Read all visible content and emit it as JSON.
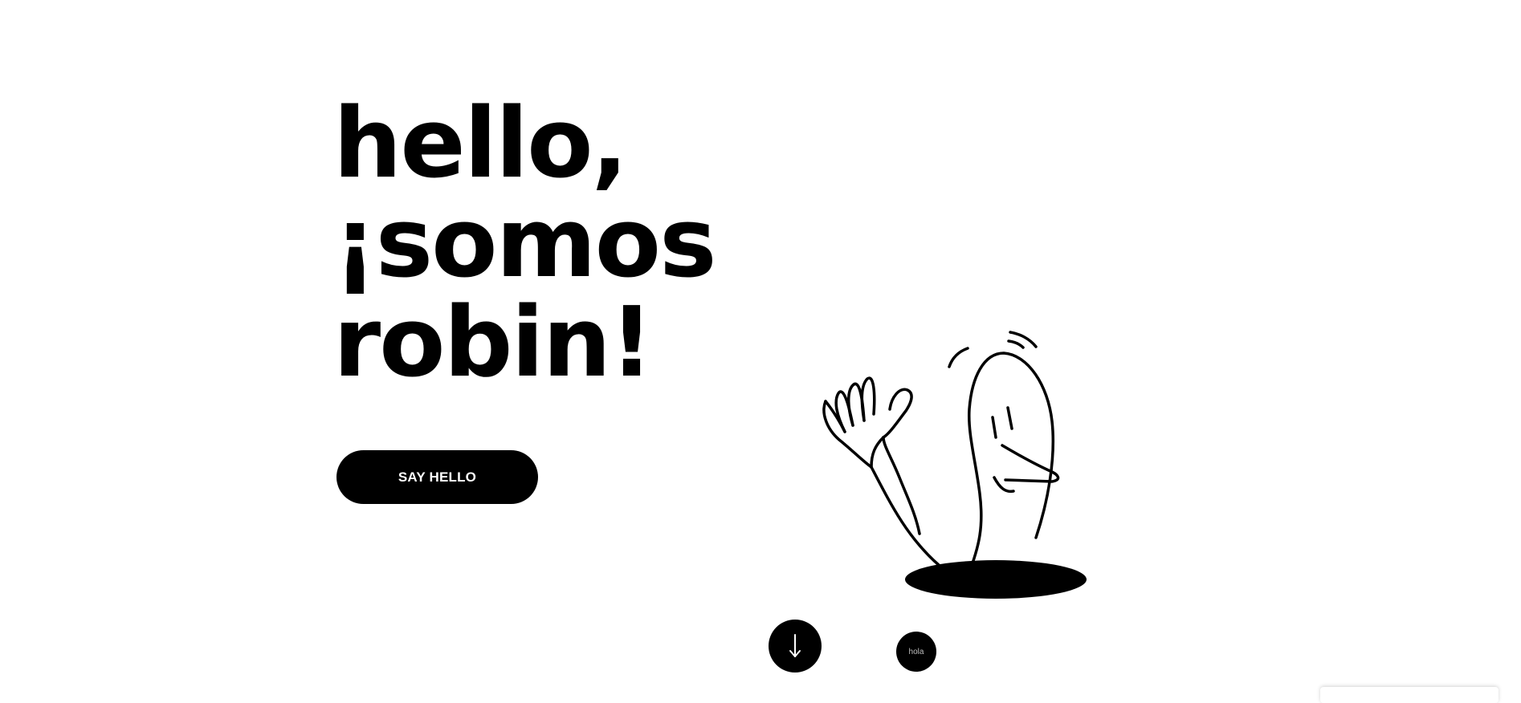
{
  "hero": {
    "line1": "hello,",
    "line2": "¡somos",
    "line3": "robin!"
  },
  "cta": {
    "label": "SAY HELLO"
  },
  "illustration": {
    "icon": "waving-character-illustration"
  },
  "scroll_button": {
    "icon": "arrow-down-icon"
  },
  "chat_button": {
    "label": "hola"
  },
  "colors": {
    "background": "#ffffff",
    "ink": "#000000",
    "button_text": "#ffffff"
  }
}
